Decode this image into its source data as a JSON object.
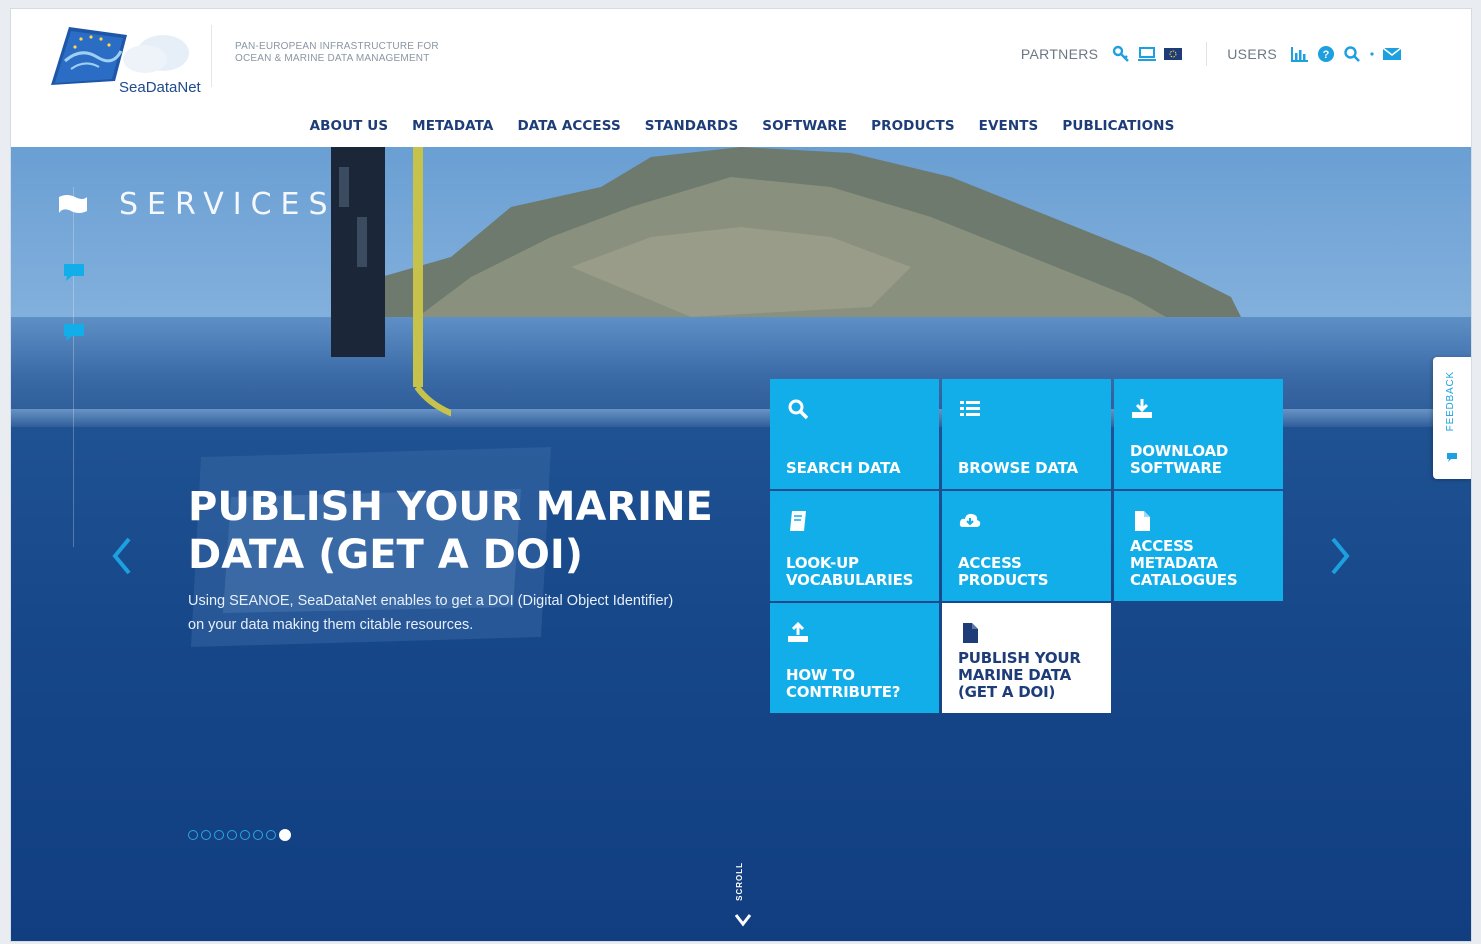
{
  "brand": {
    "name": "SeaDataNet",
    "tagline_line1": "PAN-EUROPEAN INFRASTRUCTURE FOR",
    "tagline_line2": "OCEAN & MARINE DATA MANAGEMENT"
  },
  "top_right": {
    "partners_label": "PARTNERS",
    "users_label": "USERS",
    "icon_color": "#1ca0e0"
  },
  "nav": {
    "items": [
      "ABOUT US",
      "METADATA",
      "DATA ACCESS",
      "STANDARDS",
      "SOFTWARE",
      "PRODUCTS",
      "EVENTS",
      "PUBLICATIONS"
    ]
  },
  "hero": {
    "services_label": "SERVICES",
    "slide_title": "PUBLISH YOUR MARINE DATA (GET A DOI)",
    "slide_description": "Using SEANOE, SeaDataNet enables to get a DOI (Digital Object Identifier) on your data making them citable resources.",
    "dots_total": 8,
    "dots_active_index": 7,
    "scroll_label": "SCROLL",
    "feedback_label": "FEEDBACK"
  },
  "services_grid": {
    "tiles": [
      {
        "label": "SEARCH DATA",
        "icon": "search-icon",
        "active": false
      },
      {
        "label": "BROWSE DATA",
        "icon": "list-icon",
        "active": false
      },
      {
        "label": "DOWNLOAD SOFTWARE",
        "icon": "download-icon",
        "active": false
      },
      {
        "label": "LOOK-UP VOCABULARIES",
        "icon": "book-icon",
        "active": false
      },
      {
        "label": "ACCESS PRODUCTS",
        "icon": "cloud-download-icon",
        "active": false
      },
      {
        "label": "ACCESS METADATA CATALOGUES",
        "icon": "document-icon",
        "active": false
      },
      {
        "label": "HOW TO CONTRIBUTE?",
        "icon": "upload-icon",
        "active": false
      },
      {
        "label": "PUBLISH YOUR MARINE DATA (GET A DOI)",
        "icon": "document-icon",
        "active": true
      }
    ]
  },
  "colors": {
    "nav_text": "#1d3c78",
    "tile_bg": "#12aee9",
    "accent": "#1ca0e0"
  }
}
